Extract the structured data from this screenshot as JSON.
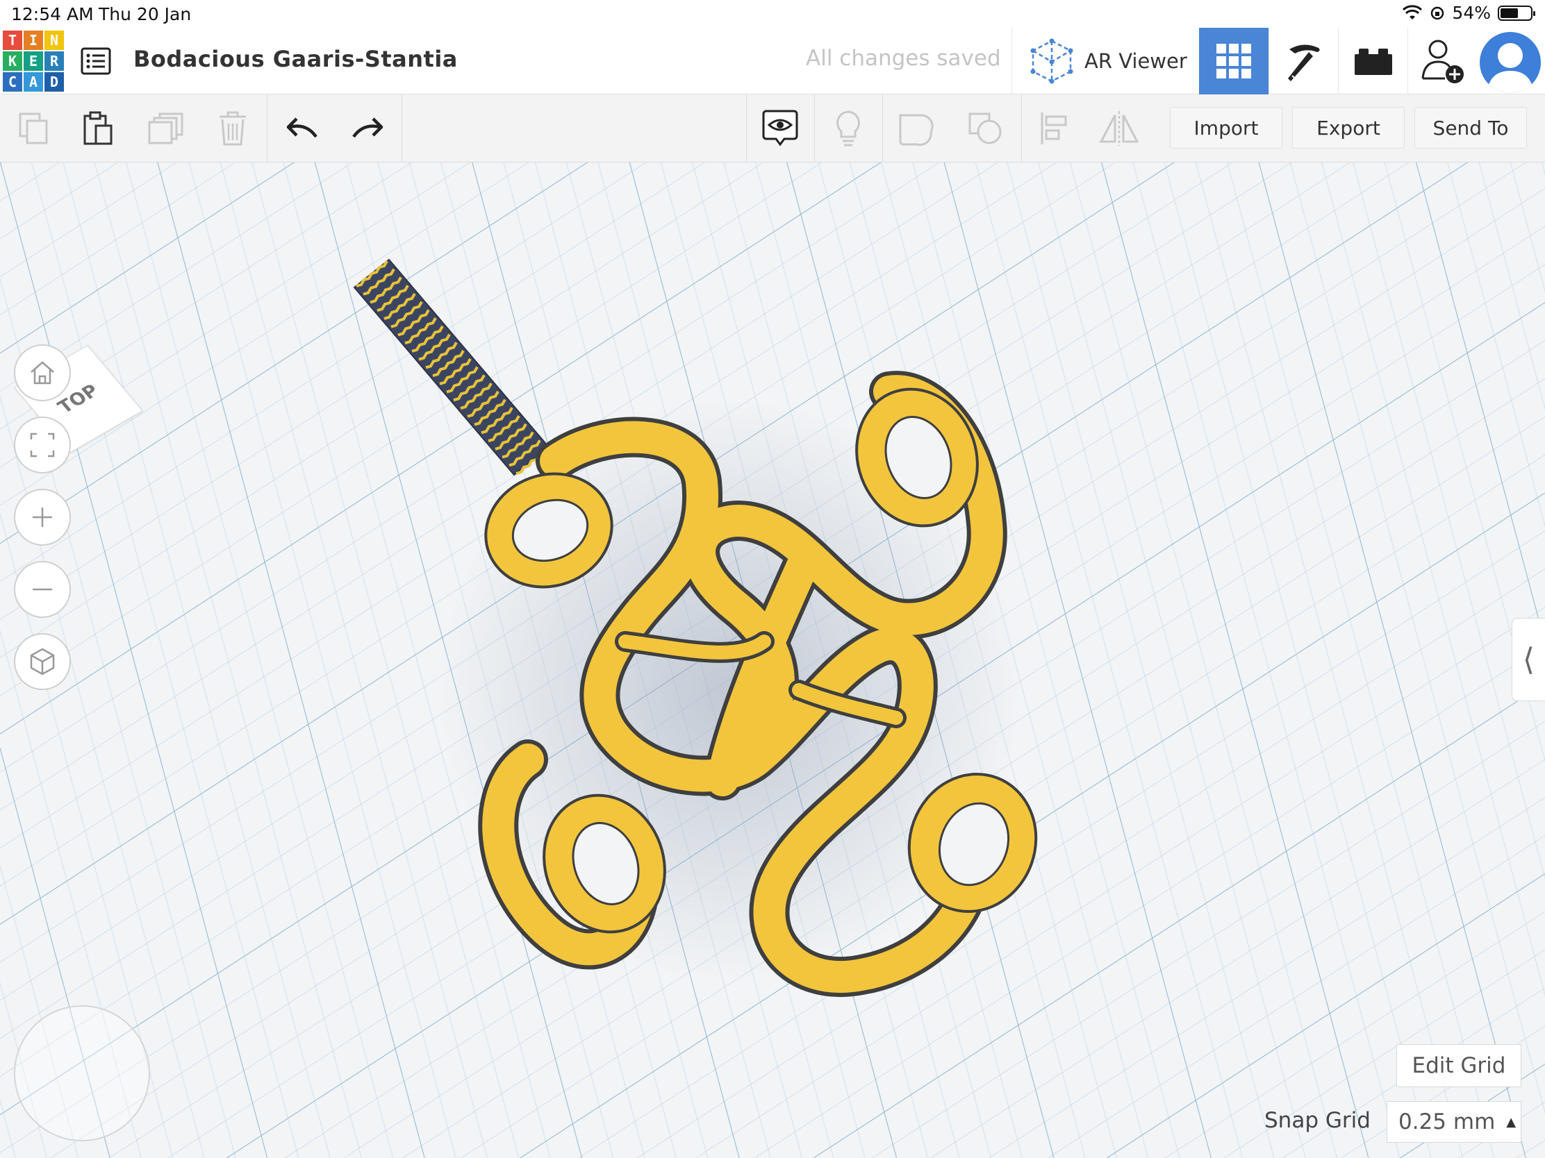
{
  "status_bar": {
    "time": "12:54 AM",
    "date": "Thu 20 Jan",
    "battery": "54%"
  },
  "header": {
    "logo_letters": [
      "T",
      "I",
      "N",
      "K",
      "E",
      "R",
      "C",
      "A",
      "D"
    ],
    "logo_colors": [
      "#e74c3c",
      "#e67e22",
      "#f1c40f",
      "#27ae60",
      "#16a085",
      "#2980b9",
      "#2c6fbf",
      "#3498db",
      "#1f5fa8"
    ],
    "design_title": "Bodacious Gaaris-Stantia",
    "save_status": "All changes saved",
    "ar_viewer_label": "AR Viewer",
    "active_mode_color": "#4a85d6"
  },
  "toolbar": {
    "import_label": "Import",
    "export_label": "Export",
    "send_to_label": "Send To"
  },
  "workplane": {
    "viewcube_label": "TOP",
    "edit_grid_label": "Edit Grid",
    "snap_grid_label": "Snap Grid",
    "snap_grid_value": "0.25 mm",
    "model_color": "#f2c53d",
    "grid_color": "#a8c8e0"
  }
}
